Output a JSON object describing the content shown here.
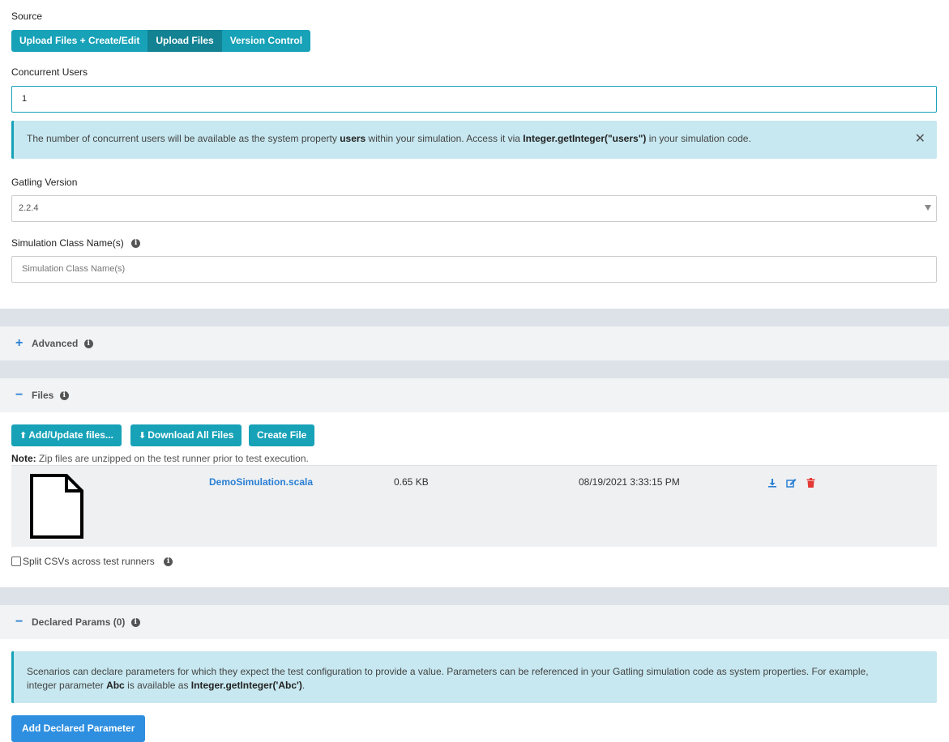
{
  "source": {
    "label": "Source",
    "options": [
      "Upload Files + Create/Edit",
      "Upload Files",
      "Version Control"
    ],
    "selected": "Upload Files"
  },
  "concurrent_users": {
    "label": "Concurrent Users",
    "value": "1",
    "info": {
      "prefix": "The number of concurrent users will be available as the system property ",
      "prop": "users",
      "middle": " within your simulation. Access it via ",
      "code": "Integer.getInteger(\"users\")",
      "suffix": " in your simulation code."
    }
  },
  "gatling_version": {
    "label": "Gatling Version",
    "value": "2.2.4"
  },
  "simulation_class": {
    "label": "Simulation Class Name(s)",
    "placeholder": "Simulation Class Name(s)"
  },
  "sections": {
    "advanced": {
      "toggle": "+",
      "title": "Advanced"
    },
    "files": {
      "toggle": "−",
      "title": "Files"
    },
    "params": {
      "toggle": "−",
      "title": "Declared Params (0)"
    }
  },
  "files": {
    "buttons": {
      "add_update": "Add/Update files...",
      "download_all": "Download All Files",
      "create": "Create File"
    },
    "note_label": "Note:",
    "note_text": " Zip files are unzipped on the test runner prior to test execution.",
    "items": [
      {
        "name": "DemoSimulation.scala",
        "size": "0.65 KB",
        "modified": "08/19/2021 3:33:15 PM"
      }
    ],
    "split_csv_label": "Split CSVs across test runners"
  },
  "declared_params": {
    "info": {
      "line1": "Scenarios can declare parameters for which they expect the test configuration to provide a value. Parameters can be referenced in your Gatling simulation code as system properties. For example,",
      "prefix": "integer parameter ",
      "param": "Abc",
      "middle": " is available as ",
      "code": "Integer.getInteger('Abc')",
      "suffix": "."
    },
    "add_button": "Add Declared Parameter"
  },
  "colors": {
    "teal": "#17a2b8",
    "teal_active": "#138293",
    "link_blue": "#2a7fd4",
    "primary_blue": "#2e8fe0",
    "delete_red": "#e53935"
  }
}
